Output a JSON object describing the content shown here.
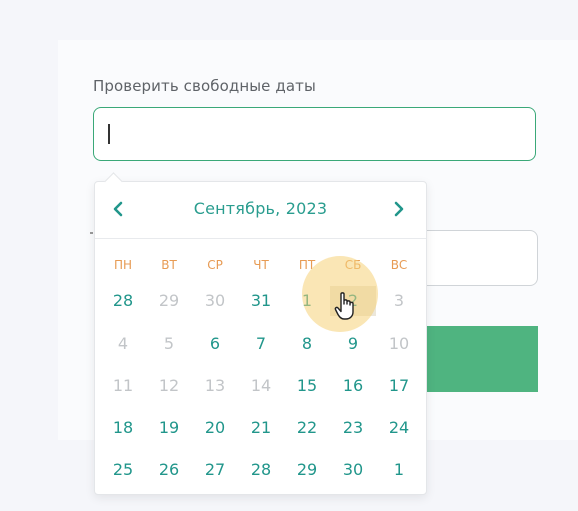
{
  "form": {
    "label": "Проверить свободные даты",
    "date_input_value": ""
  },
  "calendar": {
    "month_title": "Сентябрь, 2023",
    "prev_icon": "chevron-left-icon",
    "next_icon": "chevron-right-icon",
    "weekdays": [
      "ПН",
      "ВТ",
      "СР",
      "ЧТ",
      "ПТ",
      "СБ",
      "ВС"
    ],
    "weeks": [
      [
        {
          "d": "28",
          "s": "active"
        },
        {
          "d": "29",
          "s": "muted"
        },
        {
          "d": "30",
          "s": "muted"
        },
        {
          "d": "31",
          "s": "active"
        },
        {
          "d": "1",
          "s": "active"
        },
        {
          "d": "2",
          "s": "hover"
        },
        {
          "d": "3",
          "s": "muted"
        }
      ],
      [
        {
          "d": "4",
          "s": "muted"
        },
        {
          "d": "5",
          "s": "muted"
        },
        {
          "d": "6",
          "s": "active"
        },
        {
          "d": "7",
          "s": "active"
        },
        {
          "d": "8",
          "s": "active"
        },
        {
          "d": "9",
          "s": "active"
        },
        {
          "d": "10",
          "s": "muted"
        }
      ],
      [
        {
          "d": "11",
          "s": "muted"
        },
        {
          "d": "12",
          "s": "muted"
        },
        {
          "d": "13",
          "s": "muted"
        },
        {
          "d": "14",
          "s": "muted"
        },
        {
          "d": "15",
          "s": "active"
        },
        {
          "d": "16",
          "s": "active"
        },
        {
          "d": "17",
          "s": "active"
        }
      ],
      [
        {
          "d": "18",
          "s": "active"
        },
        {
          "d": "19",
          "s": "active"
        },
        {
          "d": "20",
          "s": "active"
        },
        {
          "d": "21",
          "s": "active"
        },
        {
          "d": "22",
          "s": "active"
        },
        {
          "d": "23",
          "s": "active"
        },
        {
          "d": "24",
          "s": "active"
        }
      ],
      [
        {
          "d": "25",
          "s": "active"
        },
        {
          "d": "26",
          "s": "active"
        },
        {
          "d": "27",
          "s": "active"
        },
        {
          "d": "28",
          "s": "active"
        },
        {
          "d": "29",
          "s": "active"
        },
        {
          "d": "30",
          "s": "active"
        },
        {
          "d": "1",
          "s": "active"
        }
      ]
    ]
  },
  "colors": {
    "accent": "#21968b",
    "weekday": "#e79b54",
    "muted": "#c2c5c8",
    "input_border": "#3aa878",
    "button": "#4fb480"
  },
  "cursor": {
    "icon": "hand-pointer-icon"
  }
}
